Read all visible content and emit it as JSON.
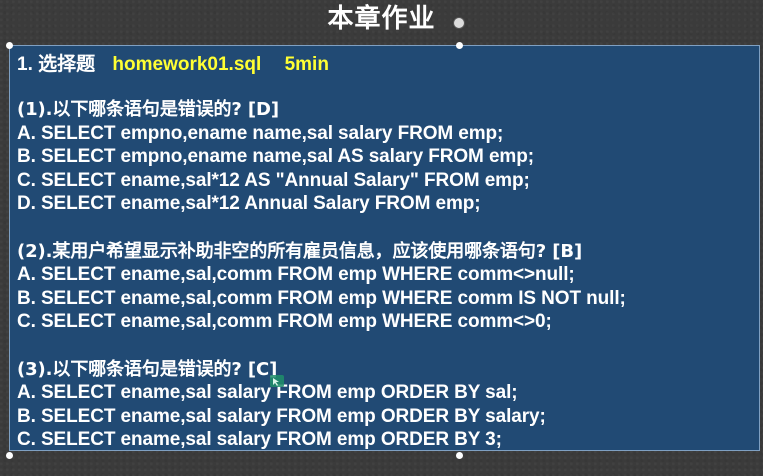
{
  "slide": {
    "title": "本章作业"
  },
  "section": {
    "number": "1. 选择题",
    "file": "homework01.sql",
    "time": "5min"
  },
  "questions": [
    {
      "title": "(1).以下哪条语句是错误的? [D]",
      "options": [
        "A. SELECT empno,ename  name,sal salary FROM emp;",
        "B. SELECT empno,ename name,sal AS salary FROM emp;",
        "C. SELECT ename,sal*12 AS \"Annual Salary\" FROM emp;",
        "D. SELECT ename,sal*12  Annual Salary FROM emp;"
      ]
    },
    {
      "title": "(2).某用户希望显示补助非空的所有雇员信息，应该使用哪条语句?  [B]",
      "options": [
        "A. SELECT ename,sal,comm FROM emp WHERE comm<>null;",
        "B. SELECT ename,sal,comm FROM emp WHERE comm IS NOT null;",
        "C. SELECT ename,sal,comm FROM emp WHERE comm<>0;"
      ]
    },
    {
      "title": "(3).以下哪条语句是错误的? [C]",
      "options": [
        "A. SELECT ename,sal salary FROM emp ORDER BY sal;",
        "B. SELECT ename,sal salary FROM emp ORDER BY salary;",
        "C. SELECT ename,sal salary FROM emp ORDER BY 3;"
      ]
    }
  ],
  "colors": {
    "panel": "#214a74",
    "highlight": "#ffff33",
    "text": "#ffffff",
    "background": "#3b3b3b"
  },
  "icons": [
    "rotate-handle-icon",
    "resize-handle-icon",
    "cursor-icon"
  ]
}
